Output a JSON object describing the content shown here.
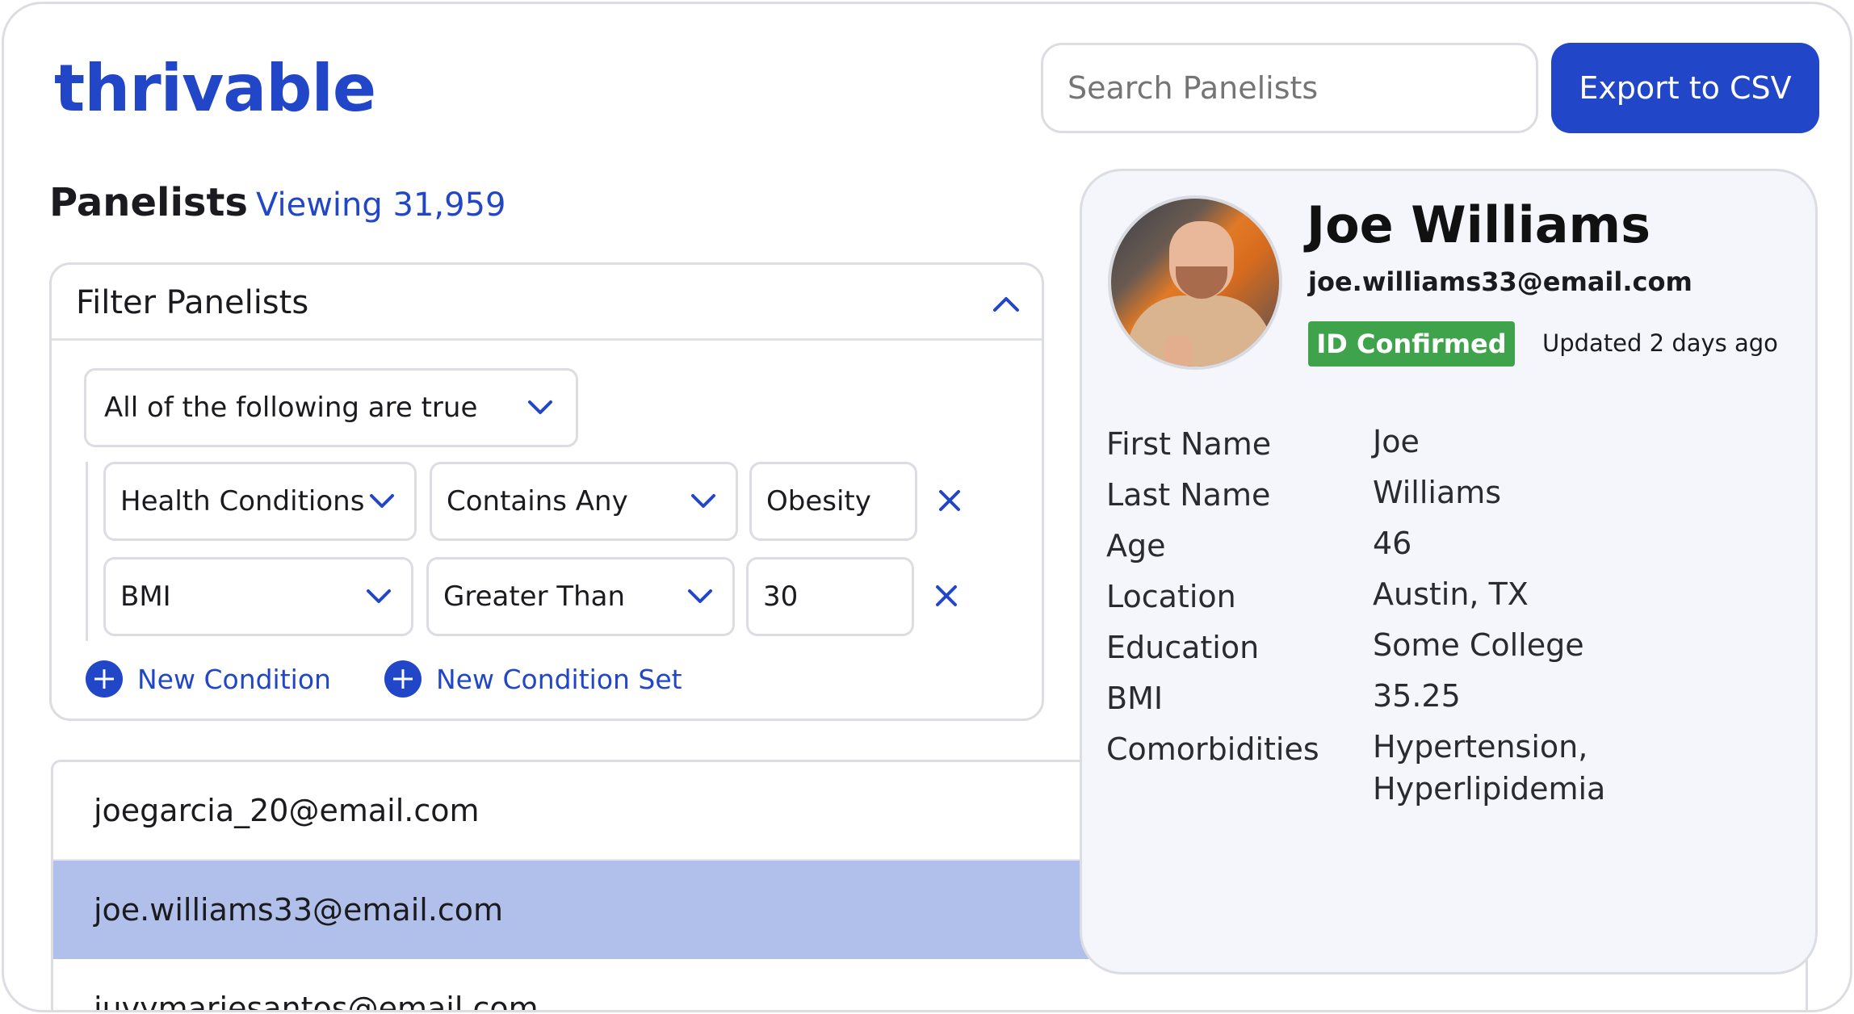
{
  "brand": {
    "logo": "thrivable"
  },
  "header": {
    "search_placeholder": "Search Panelists",
    "export_label": "Export to CSV"
  },
  "panelists": {
    "title": "Panelists",
    "viewing": "Viewing 31,959"
  },
  "filter": {
    "title": "Filter Panelists",
    "logic": "All of the following are true",
    "conditions": [
      {
        "field": "Health Conditions",
        "operator": "Contains Any",
        "value": "Obesity"
      },
      {
        "field": "BMI",
        "operator": "Greater Than",
        "value": "30"
      }
    ],
    "new_condition": "New Condition",
    "new_condition_set": "New Condition Set"
  },
  "list": {
    "rows": [
      "joegarcia_20@email.com",
      "joe.williams33@email.com",
      "juvymariesantos@email.com"
    ],
    "selected_index": 1
  },
  "profile": {
    "name": "Joe Williams",
    "email": "joe.williams33@email.com",
    "badge": "ID Confirmed",
    "updated": "Updated 2 days ago",
    "fields": [
      {
        "label": "First Name",
        "value": "Joe"
      },
      {
        "label": "Last Name",
        "value": "Williams"
      },
      {
        "label": "Age",
        "value": "46"
      },
      {
        "label": "Location",
        "value": "Austin, TX"
      },
      {
        "label": "Education",
        "value": "Some College"
      },
      {
        "label": "BMI",
        "value": "35.25"
      },
      {
        "label": "Comorbidities",
        "value": "Hypertension, Hyperlipidemia"
      }
    ]
  },
  "colors": {
    "brand_blue": "#2146c7",
    "badge_green": "#3ea34b",
    "selected_row": "#b1c0ea"
  }
}
